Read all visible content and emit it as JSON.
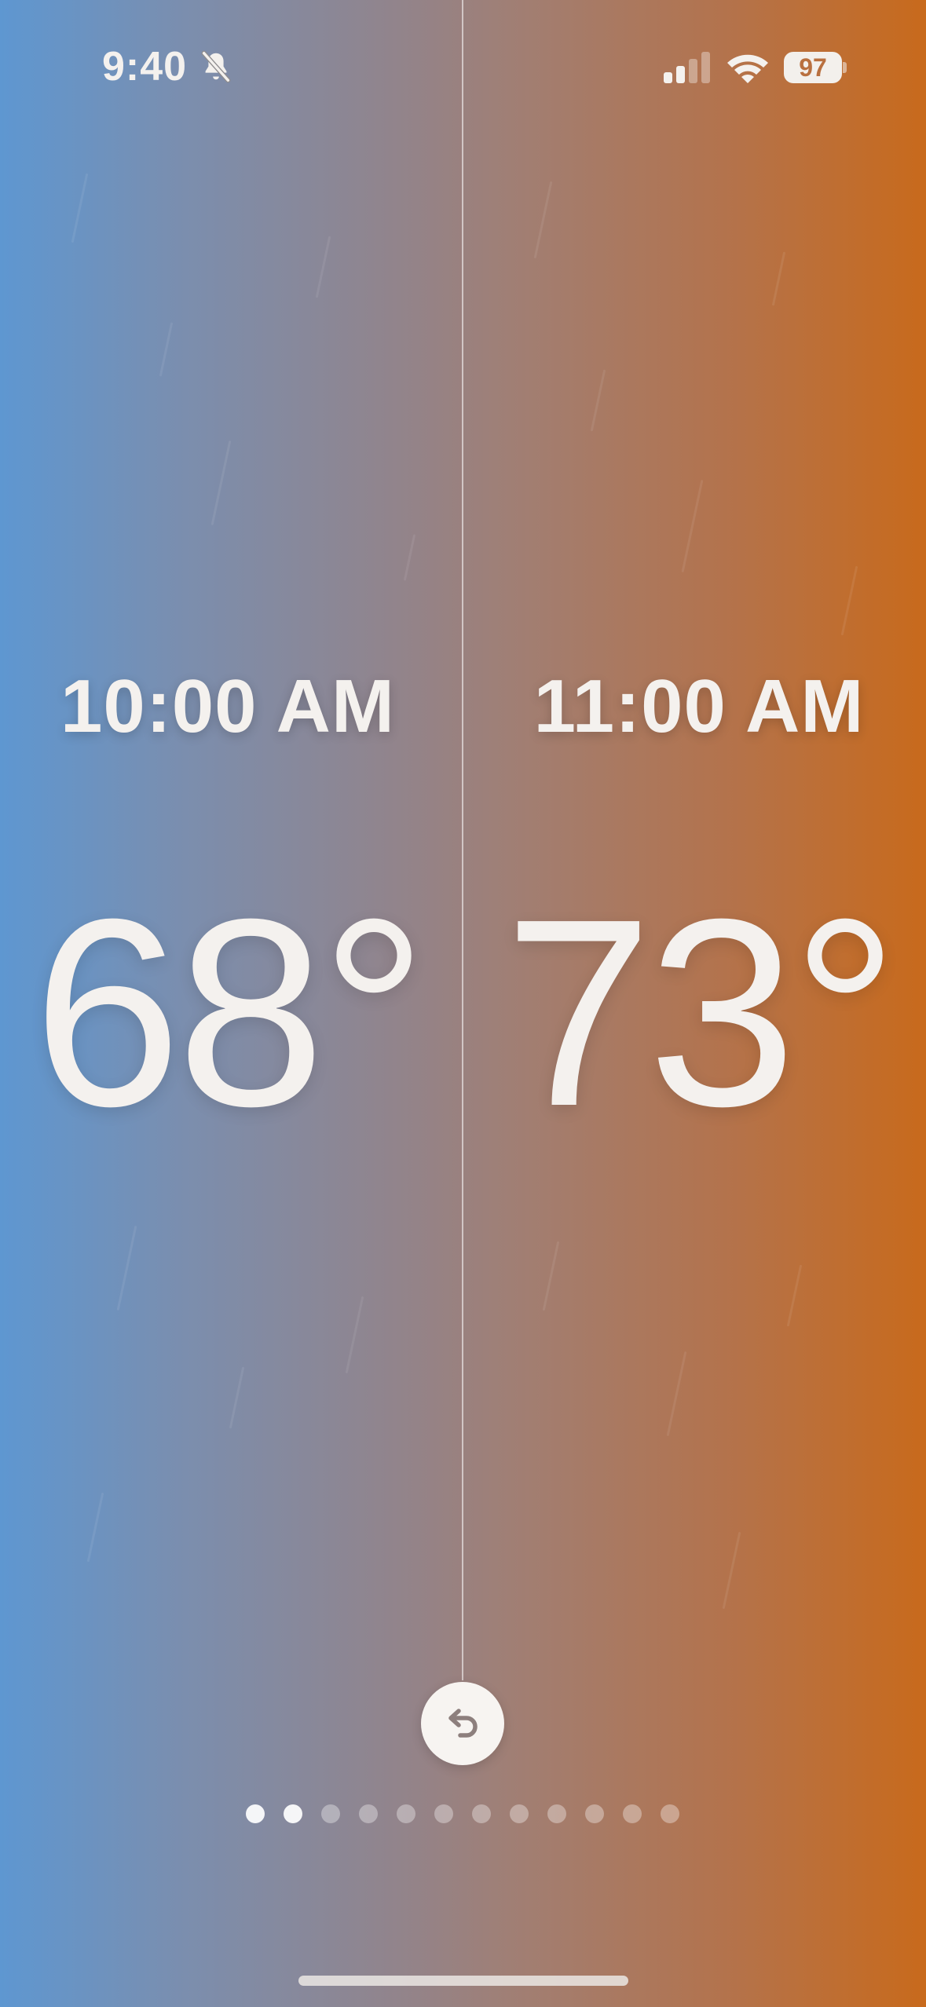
{
  "status_bar": {
    "time": "9:40",
    "battery_level": "97",
    "icons": [
      "bell-slash-icon",
      "cellular-signal-icon",
      "wifi-icon",
      "battery-icon"
    ]
  },
  "comparison": {
    "left": {
      "hour": "10:00 AM",
      "temperature": "68°"
    },
    "right": {
      "hour": "11:00 AM",
      "temperature": "73°"
    }
  },
  "controls": {
    "undo_icon": "undo-arrow-icon"
  },
  "pagination": {
    "total": 12,
    "current": 2
  },
  "colors": {
    "gradient_left": "#5e97d1",
    "gradient_mid": "#948388",
    "gradient_right": "#c86a1c",
    "text": "#f4f1ee"
  }
}
